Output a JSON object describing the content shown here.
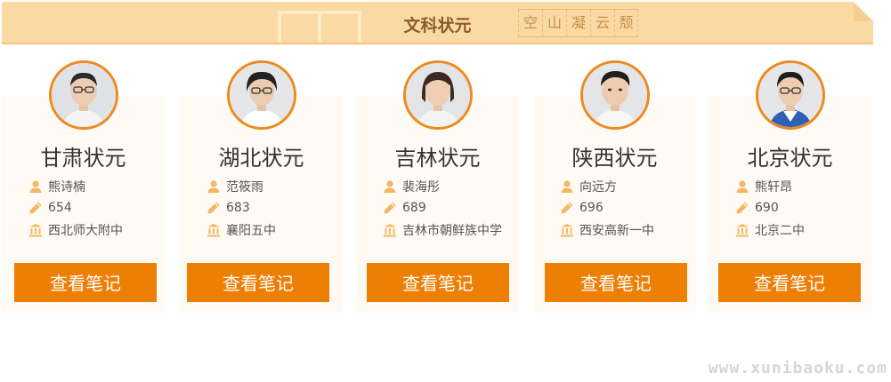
{
  "banner": {
    "title": "文科状元",
    "deco_chars": [
      "空",
      "山",
      "凝",
      "云",
      "颓"
    ]
  },
  "icons": {
    "name": "person-icon",
    "score": "pencil-icon",
    "school": "school-building-icon"
  },
  "colors": {
    "accent": "#ee7f05",
    "avatar_border": "#ee8a1c",
    "banner": "#fbd9a2",
    "icon": "#f2b863"
  },
  "cards": [
    {
      "title": "甘肃状元",
      "name": "熊诗楠",
      "score": "654",
      "school": "西北师大附中",
      "button": "查看笔记"
    },
    {
      "title": "湖北状元",
      "name": "范筱雨",
      "score": "683",
      "school": "襄阳五中",
      "button": "查看笔记"
    },
    {
      "title": "吉林状元",
      "name": "裴海彤",
      "score": "689",
      "school": "吉林市朝鲜族中学",
      "button": "查看笔记"
    },
    {
      "title": "陕西状元",
      "name": "向远方",
      "score": "696",
      "school": "西安高新一中",
      "button": "查看笔记"
    },
    {
      "title": "北京状元",
      "name": "熊轩昂",
      "score": "690",
      "school": "北京二中",
      "button": "查看笔记"
    }
  ],
  "watermark": "www.xunibaoku.com"
}
